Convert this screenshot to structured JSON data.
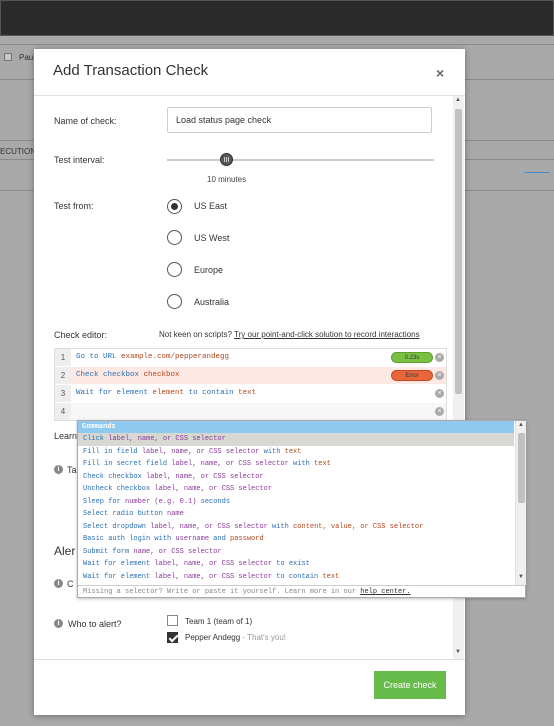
{
  "background": {
    "user_label": "Pau",
    "column_fragment": "ECUTION"
  },
  "modal": {
    "title": "Add Transaction Check",
    "close_glyph": "×",
    "name_label": "Name of check:",
    "name_value": "Load status page check",
    "interval_label": "Test interval:",
    "interval_value": "10 minutes",
    "from_label": "Test from:",
    "regions": [
      {
        "label": "US East",
        "selected": true
      },
      {
        "label": "US West",
        "selected": false
      },
      {
        "label": "Europe",
        "selected": false
      },
      {
        "label": "Australia",
        "selected": false
      }
    ],
    "editor_label": "Check editor:",
    "editor_note_prefix": "Not keen on scripts?",
    "editor_note_link": "Try our point-and-click solution to record interactions",
    "editor_lines": [
      {
        "num": "1",
        "cmd": "Go to URL",
        "arg": "example.com/pepperandegg",
        "status": "0.23s"
      },
      {
        "num": "2",
        "cmd": "Check checkbox",
        "arg": "checkbox",
        "status": "Error"
      },
      {
        "num": "3",
        "cmd": "Wait for element",
        "arg": "element",
        "cmd2": "to contain",
        "arg2": "text"
      },
      {
        "num": "4"
      }
    ],
    "learn_fragment": "Learn",
    "info_fragment_1": "Ta",
    "alerts_fragment": "Aler",
    "info_fragment_2": "C",
    "who_label": "Who to alert?",
    "team_label": "Team 1 (team of 1)",
    "user_name": "Pepper Andegg",
    "user_suffix": " - That's you!",
    "create_button": "Create check"
  },
  "autocomplete": {
    "header": "Commands",
    "items": [
      {
        "cmd": "Click",
        "args": "label, name, or CSS selector"
      },
      {
        "cmd": "Fill in field",
        "args": "label, name, or CSS selector",
        "conj": "with",
        "tail": "text"
      },
      {
        "cmd": "Fill in secret field",
        "args": "label, name, or CSS selector",
        "conj": "with",
        "tail": "text"
      },
      {
        "cmd": "Check checkbox",
        "args": "label, name, or CSS selector"
      },
      {
        "cmd": "Uncheck checkbox",
        "args": "label, name, or CSS selector"
      },
      {
        "cmd": "Sleep for",
        "args": "number (e.g. 0.1)",
        "conj": "seconds"
      },
      {
        "cmd": "Select radio button",
        "args": "name"
      },
      {
        "cmd": "Select dropdown",
        "args": "label, name, or CSS selector",
        "conj": "with",
        "tail": "content, value, or CSS selector"
      },
      {
        "cmd": "Basic auth login with",
        "args": "username",
        "conj": "and",
        "tail": "password"
      },
      {
        "cmd": "Submit form",
        "args": "name, or CSS selector"
      },
      {
        "cmd": "Wait for element",
        "args": "label, name, or CSS selector",
        "conj": "to exist"
      },
      {
        "cmd": "Wait for element",
        "args": "label, name, or CSS selector",
        "conj": "to contain",
        "tail": "text"
      }
    ],
    "footer": "Missing a selector? Write or paste it yourself. Learn more in our",
    "footer_link": "help center."
  },
  "colors": {
    "accent_green": "#66bb4a",
    "status_ok": "#7ac043",
    "status_error": "#e8663a",
    "dropdown_header": "#8fc9ef"
  }
}
